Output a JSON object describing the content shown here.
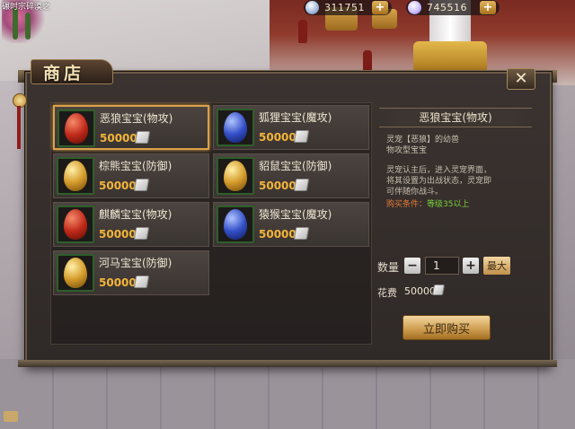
{
  "header": {
    "player_tag": "碾时宗碎漠之",
    "silver": "311751",
    "gems": "745516",
    "plus_label": "+"
  },
  "panel": {
    "title": "商店",
    "close_label": "✕"
  },
  "items": [
    {
      "name": "恶狼宝宝(物攻)",
      "price": "50000",
      "egg": "red",
      "selected": true
    },
    {
      "name": "狐狸宝宝(魔攻)",
      "price": "50000",
      "egg": "blue",
      "selected": false
    },
    {
      "name": "棕熊宝宝(防御)",
      "price": "50000",
      "egg": "gold",
      "selected": false
    },
    {
      "name": "貂鼠宝宝(防御)",
      "price": "50000",
      "egg": "gold",
      "selected": false
    },
    {
      "name": "麒麟宝宝(物攻)",
      "price": "50000",
      "egg": "red",
      "selected": false
    },
    {
      "name": "猿猴宝宝(魔攻)",
      "price": "50000",
      "egg": "blue",
      "selected": false
    },
    {
      "name": "河马宝宝(防御)",
      "price": "50000",
      "egg": "gold",
      "selected": false
    }
  ],
  "detail": {
    "title": "恶狼宝宝(物攻)",
    "line1": "灵宠【恶狼】的幼兽",
    "line2": "物攻型宝宝",
    "line3": "灵宠认主后，进入灵宠界面，",
    "line4": "将其设置为出战状态，灵宠即",
    "line5": "可伴随你战斗。",
    "req_label": "购买条件：",
    "req_value": "等级35以上"
  },
  "purchase": {
    "qty_label": "数量",
    "minus_label": "−",
    "qty_value": "1",
    "plus_label": "+",
    "max_label": "最大",
    "cost_label": "花费",
    "cost_value": "50000",
    "buy_label": "立即购买"
  },
  "colors": {
    "price": "#f3b53a",
    "selected_border": "#d9a24a",
    "requirement_value": "#7bcf3c"
  }
}
